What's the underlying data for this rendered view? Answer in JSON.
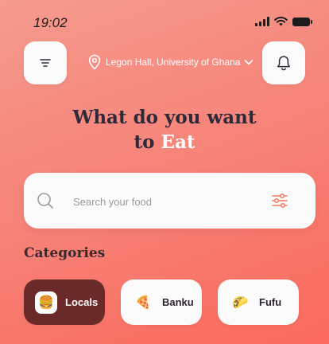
{
  "status_bar": {
    "time": "19:02"
  },
  "header": {
    "location": "Legon Hall, University of Ghana"
  },
  "hero": {
    "line1": "What do you want",
    "line2_prefix": "to",
    "line2_accent": "Eat"
  },
  "search": {
    "placeholder": "Search your food",
    "value": ""
  },
  "categories": {
    "title": "Categories",
    "items": [
      {
        "label": "Locals",
        "icon": "burger-icon",
        "glyph": "🍔",
        "active": true
      },
      {
        "label": "Banku",
        "icon": "pizza-icon",
        "glyph": "🍕",
        "active": false
      },
      {
        "label": "Fufu",
        "icon": "taco-icon",
        "glyph": "🌮",
        "active": false
      }
    ]
  },
  "colors": {
    "background_start": "#f59a8e",
    "background_end": "#fb6a5d",
    "accent_dark": "#6b2a2a",
    "heading_text": "#2e2a3a",
    "card": "#fbfbfb",
    "filter_accent": "#f07a5e"
  }
}
